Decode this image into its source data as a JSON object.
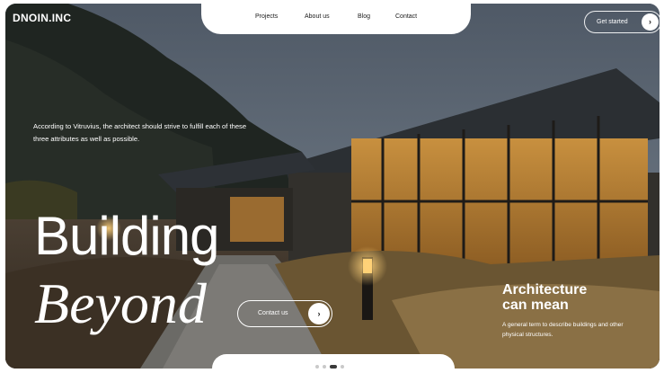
{
  "brand": {
    "name": "DNOIN.INC"
  },
  "nav": {
    "items": [
      {
        "label": "Projects"
      },
      {
        "label": "About us"
      },
      {
        "label": "Blog"
      },
      {
        "label": "Contact"
      }
    ]
  },
  "header": {
    "cta_label": "Get started"
  },
  "hero": {
    "quote": "According to Vitruvius, the architect should strive to fulfill each of these three attributes as well as possible.",
    "headline_line1": "Building",
    "headline_line2": "Beyond",
    "contact_label": "Contact us"
  },
  "side": {
    "title_line1": "Architecture",
    "title_line2": "can mean",
    "text": "A general term to describe buildings and other physical structures."
  },
  "pager": {
    "count": 4,
    "active_index": 2
  },
  "icons": {
    "arrow": "arrow-right-icon"
  }
}
